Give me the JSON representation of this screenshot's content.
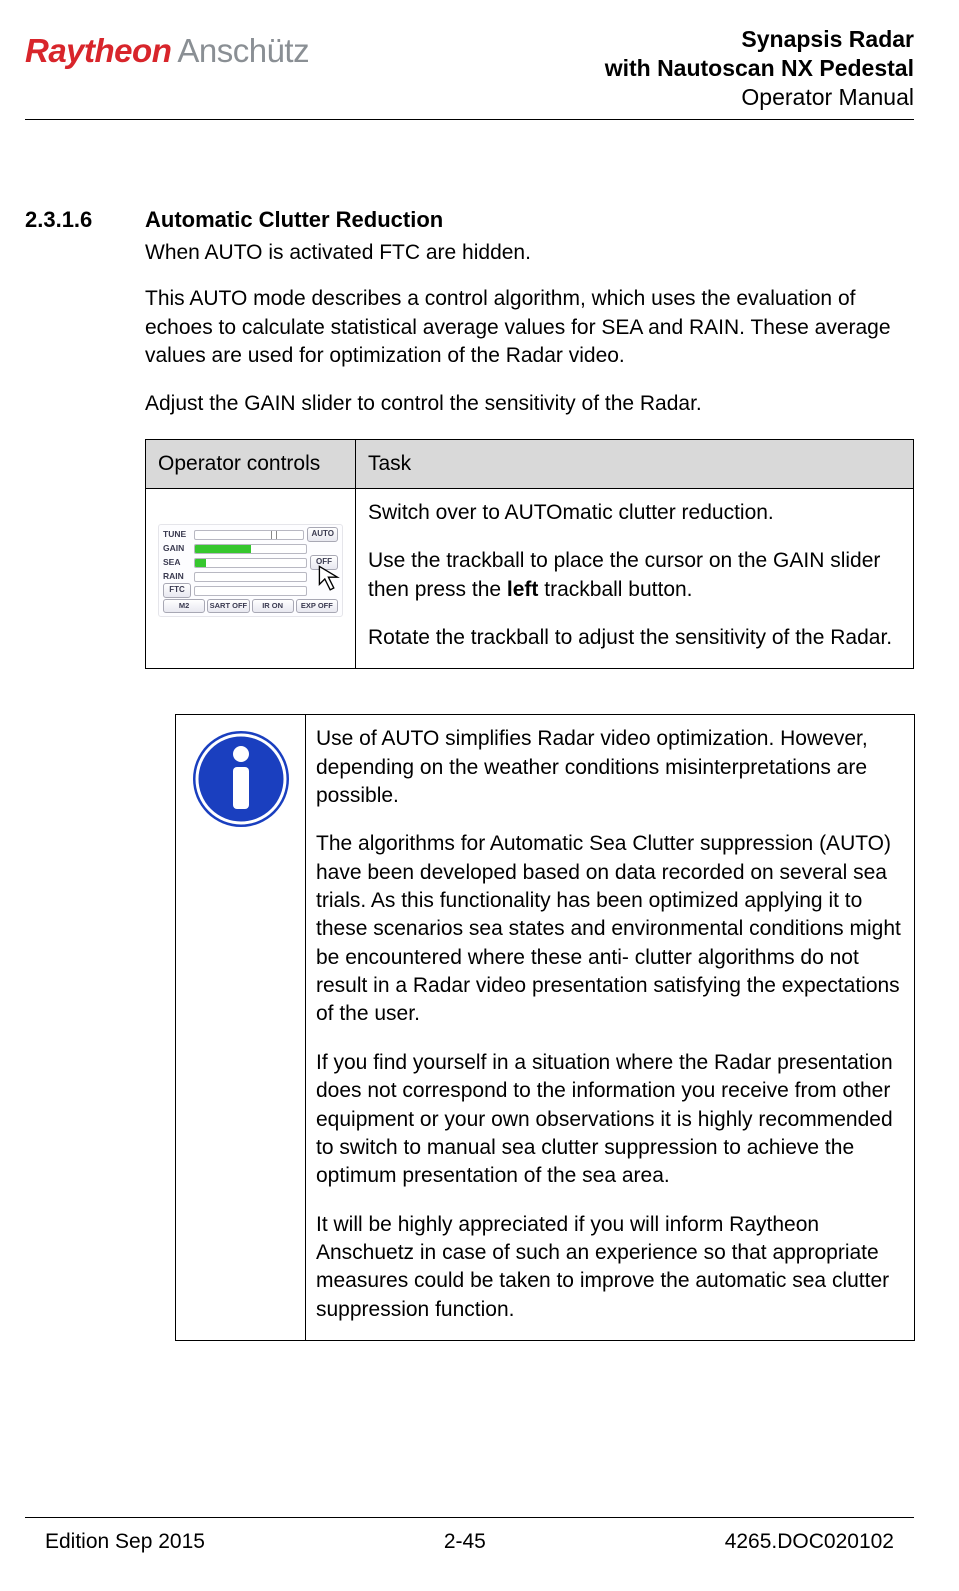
{
  "logo": {
    "raytheon": "Raytheon",
    "anschutz": "Anschütz"
  },
  "docTitle": {
    "line1": "Synapsis Radar",
    "line2": "with Nautoscan NX Pedestal",
    "line3": "Operator Manual"
  },
  "section": {
    "number": "2.3.1.6",
    "title": "Automatic Clutter Reduction",
    "p1": "When AUTO is activated FTC are hidden.",
    "p2": "This AUTO mode describes a control algorithm, which uses the evaluation of echoes to calculate statistical average values for SEA and RAIN. These average values are used for optimization of the Radar video.",
    "p3": "Adjust the GAIN slider to control the sensitivity of the Radar."
  },
  "table": {
    "headers": {
      "col1": "Operator controls",
      "col2": "Task"
    },
    "controls": {
      "tune": "TUNE",
      "gain": "GAIN",
      "sea": "SEA",
      "rain": "RAIN",
      "ftc": "FTC",
      "auto": "AUTO",
      "off": "OFF",
      "m2": "M2",
      "sartoff": "SART OFF",
      "iron": "IR ON",
      "expoff": "EXP OFF"
    },
    "task": {
      "p1": "Switch over to AUTOmatic clutter reduction.",
      "p2a": "Use the trackball to place the cursor on the GAIN slider then press the ",
      "p2bold": "left",
      "p2b": " trackball button.",
      "p3": "Rotate the trackball to adjust the sensitivity of the Radar."
    }
  },
  "note": {
    "p1": "Use of AUTO simplifies Radar video optimization. However, depending on the weather conditions misinterpretations are possible.",
    "p2": "The algorithms for Automatic Sea Clutter suppression (AUTO) have been developed based on data recorded on several sea trials. As this functionality has been optimized applying it to these scenarios sea states and environmental conditions might be encountered where these anti- clutter algorithms do not result in a Radar video presentation satisfying the expectations of the user.",
    "p3": "If you find yourself in a situation where the Radar presentation does not correspond to the information you receive from other equipment or your own observations it is highly recommended to switch to manual sea clutter suppression to achieve the optimum presentation of the sea area.",
    "p4": "It will be highly appreciated if you will inform Raytheon Anschuetz in case of such an experience so that appropriate measures could be taken to improve the automatic sea clutter suppression function."
  },
  "footer": {
    "edition": "Edition Sep 2015",
    "pagenum": "2-45",
    "docnum": "4265.DOC020102"
  }
}
